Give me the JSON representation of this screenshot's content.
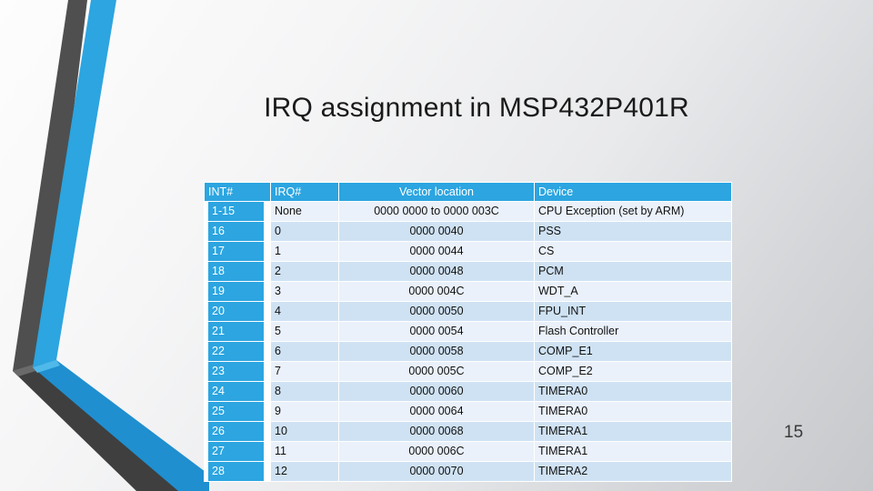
{
  "slide": {
    "title": "IRQ assignment in MSP432P401R",
    "page_number": "15"
  },
  "theme": {
    "accent_blue": "#2ca5e0",
    "chevron_blue_light": "#2ca5e0",
    "chevron_blue_dark": "#1b86c6",
    "chevron_gray": "#545454",
    "chevron_gray_dark": "#3c3c3c",
    "row_light": "#eaf1fa",
    "row_dark": "#cfe2f3",
    "header_text": "#ffffff",
    "body_text": "#111111",
    "background_top": "#fdfdfd",
    "background_bottom": "#c6c8cb"
  },
  "table": {
    "headers": [
      "INT#",
      "IRQ#",
      "Vector location",
      "Device"
    ],
    "rows": [
      {
        "int": "1-15",
        "irq": "None",
        "vector": "0000 0000 to 0000 003C",
        "device": "CPU Exception (set by ARM)"
      },
      {
        "int": "16",
        "irq": "0",
        "vector": "0000 0040",
        "device": "PSS"
      },
      {
        "int": "17",
        "irq": "1",
        "vector": "0000 0044",
        "device": "CS"
      },
      {
        "int": "18",
        "irq": "2",
        "vector": "0000 0048",
        "device": "PCM"
      },
      {
        "int": "19",
        "irq": "3",
        "vector": "0000 004C",
        "device": "WDT_A"
      },
      {
        "int": "20",
        "irq": "4",
        "vector": "0000 0050",
        "device": "FPU_INT"
      },
      {
        "int": "21",
        "irq": "5",
        "vector": "0000 0054",
        "device": "Flash Controller"
      },
      {
        "int": "22",
        "irq": "6",
        "vector": "0000 0058",
        "device": "COMP_E1"
      },
      {
        "int": "23",
        "irq": "7",
        "vector": "0000 005C",
        "device": "COMP_E2"
      },
      {
        "int": "24",
        "irq": "8",
        "vector": "0000 0060",
        "device": "TIMERA0"
      },
      {
        "int": "25",
        "irq": "9",
        "vector": "0000 0064",
        "device": "TIMERA0"
      },
      {
        "int": "26",
        "irq": "10",
        "vector": "0000 0068",
        "device": "TIMERA1"
      },
      {
        "int": "27",
        "irq": "11",
        "vector": "0000 006C",
        "device": "TIMERA1"
      },
      {
        "int": "28",
        "irq": "12",
        "vector": "0000 0070",
        "device": "TIMERA2"
      }
    ]
  }
}
